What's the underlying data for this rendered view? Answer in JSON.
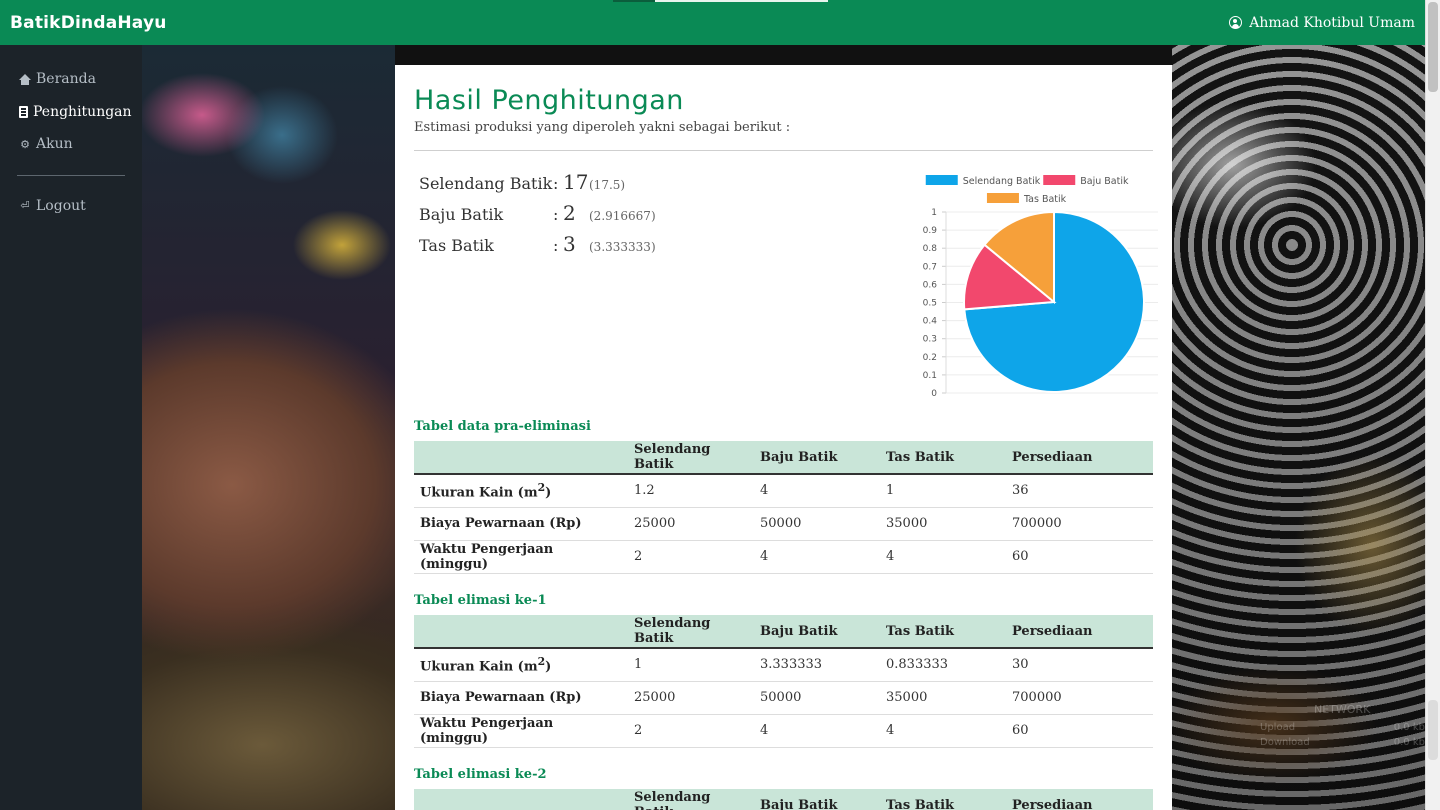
{
  "app": {
    "brand": "BatikDindaHayu",
    "user_name": "Ahmad Khotibul Umam"
  },
  "sidebar": {
    "items": [
      {
        "label": "Beranda",
        "icon": "home-icon"
      },
      {
        "label": "Penghitungan",
        "icon": "calculator-icon"
      },
      {
        "label": "Akun",
        "icon": "gear-icon"
      }
    ],
    "logout_label": "Logout"
  },
  "main": {
    "title": "Hasil Penghitungan",
    "subtitle": "Estimasi produksi yang diperoleh yakni sebagai berikut :",
    "results": [
      {
        "label": "Selendang Batik",
        "value": "17",
        "raw": "(17.5)"
      },
      {
        "label": "Baju Batik",
        "value": "2",
        "raw": "(2.916667)"
      },
      {
        "label": "Tas Batik",
        "value": "3",
        "raw": "(3.333333)"
      }
    ],
    "colon": ":"
  },
  "chart_data": {
    "type": "pie",
    "categories": [
      "Selendang Batik",
      "Baju Batik",
      "Tas Batik"
    ],
    "values": [
      17.5,
      2.916667,
      3.333333
    ],
    "colors": [
      "#0ea5e9",
      "#f2486d",
      "#f6a03a"
    ],
    "legend_position": "top",
    "axis_ticks": [
      "0",
      "0.1",
      "0.2",
      "0.3",
      "0.4",
      "0.5",
      "0.6",
      "0.7",
      "0.8",
      "0.9",
      "1"
    ],
    "grid": true
  },
  "tables": [
    {
      "title": "Tabel data pra-eliminasi",
      "headers": [
        "",
        "Selendang Batik",
        "Baju Batik",
        "Tas Batik",
        "Persediaan"
      ],
      "rows": [
        {
          "head": "Ukuran Kain (m",
          "sup": "2",
          "tail": ")",
          "cells": [
            "1.2",
            "4",
            "1",
            "36"
          ]
        },
        {
          "head": "Biaya Pewarnaan (Rp)",
          "sup": "",
          "tail": "",
          "cells": [
            "25000",
            "50000",
            "35000",
            "700000"
          ]
        },
        {
          "head": "Waktu Pengerjaan (minggu)",
          "sup": "",
          "tail": "",
          "cells": [
            "2",
            "4",
            "4",
            "60"
          ]
        }
      ]
    },
    {
      "title": "Tabel elimasi ke-1",
      "headers": [
        "",
        "Selendang Batik",
        "Baju Batik",
        "Tas Batik",
        "Persediaan"
      ],
      "rows": [
        {
          "head": "Ukuran Kain (m",
          "sup": "2",
          "tail": ")",
          "cells": [
            "1",
            "3.333333",
            "0.833333",
            "30"
          ]
        },
        {
          "head": "Biaya Pewarnaan (Rp)",
          "sup": "",
          "tail": "",
          "cells": [
            "25000",
            "50000",
            "35000",
            "700000"
          ]
        },
        {
          "head": "Waktu Pengerjaan (minggu)",
          "sup": "",
          "tail": "",
          "cells": [
            "2",
            "4",
            "4",
            "60"
          ]
        }
      ]
    },
    {
      "title": "Tabel elimasi ke-2",
      "headers": [
        "",
        "Selendang Batik",
        "Baju Batik",
        "Tas Batik",
        "Persediaan"
      ],
      "rows": []
    }
  ],
  "network_widget": {
    "title": "NETWORK",
    "upload_label": "Upload",
    "upload_value": "0.0 kb",
    "download_label": "Download",
    "download_value": "0.0 kb"
  }
}
